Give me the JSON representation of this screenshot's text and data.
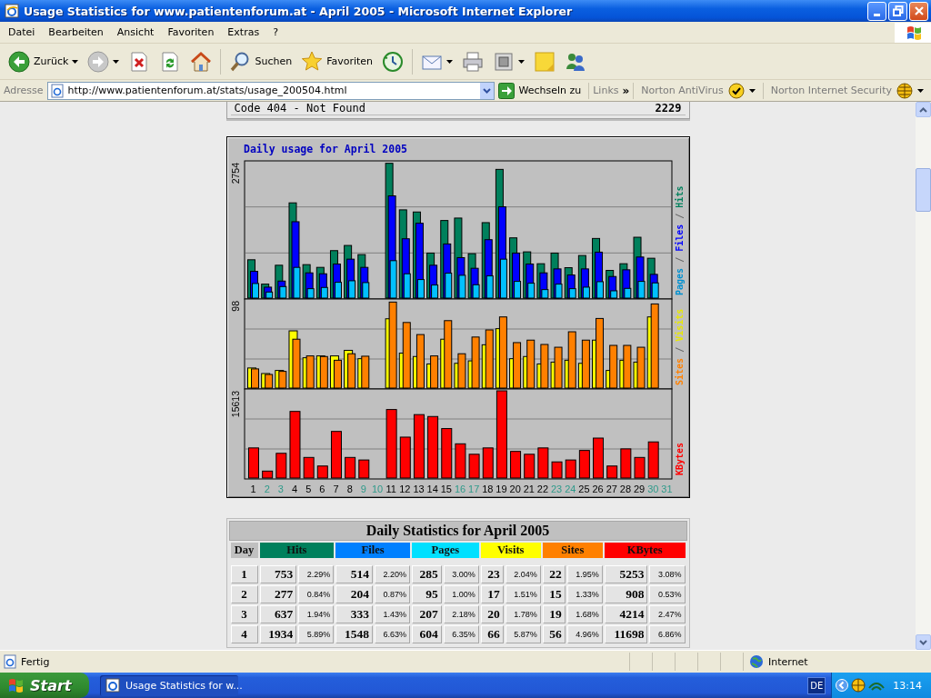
{
  "window": {
    "title": "Usage Statistics for www.patientenforum.at - April 2005 - Microsoft Internet Explorer"
  },
  "menu": [
    "Datei",
    "Bearbeiten",
    "Ansicht",
    "Favoriten",
    "Extras",
    "?"
  ],
  "toolbar": [
    {
      "kind": "back",
      "label": "Zurück"
    },
    {
      "kind": "forward"
    },
    {
      "kind": "stop"
    },
    {
      "kind": "refresh"
    },
    {
      "kind": "home"
    },
    {
      "kind": "search",
      "label": "Suchen"
    },
    {
      "kind": "favorites",
      "label": "Favoriten"
    },
    {
      "kind": "history"
    },
    {
      "kind": "mail"
    },
    {
      "kind": "print"
    },
    {
      "kind": "edit"
    },
    {
      "kind": "note"
    },
    {
      "kind": "messenger"
    }
  ],
  "address_bar": {
    "label": "Adresse",
    "value": "http://www.patientenforum.at/stats/usage_200504.html",
    "go_label": "Wechseln zu"
  },
  "links_bar": {
    "label": "Links",
    "chevron": "»",
    "items": [
      "Norton AntiVirus",
      "Norton Internet Security"
    ]
  },
  "previous_table_row": {
    "label": "Code 404 - Not Found",
    "value": "2229"
  },
  "chart": {
    "title": "Daily usage for April 2005",
    "panels": [
      {
        "max_label": "2754",
        "legend": [
          {
            "text": "Pages",
            "color": "#0090d0"
          },
          {
            "text": " / ",
            "color": "#606060"
          },
          {
            "text": "Files",
            "color": "#0000ff"
          },
          {
            "text": " / ",
            "color": "#606060"
          },
          {
            "text": "Hits",
            "color": "#00805c"
          }
        ]
      },
      {
        "max_label": "98",
        "legend": [
          {
            "text": "Sites",
            "color": "#ff8000"
          },
          {
            "text": " / ",
            "color": "#606060"
          },
          {
            "text": "Visits",
            "color": "#e8e800"
          }
        ]
      },
      {
        "max_label": "15613",
        "legend": [
          {
            "text": "KBytes",
            "color": "#ff0000"
          }
        ]
      }
    ],
    "days": [
      {
        "label": "1",
        "weekend": false
      },
      {
        "label": "2",
        "weekend": true
      },
      {
        "label": "3",
        "weekend": true
      },
      {
        "label": "4",
        "weekend": false
      },
      {
        "label": "5",
        "weekend": false
      },
      {
        "label": "6",
        "weekend": false
      },
      {
        "label": "7",
        "weekend": false
      },
      {
        "label": "8",
        "weekend": false
      },
      {
        "label": "9",
        "weekend": true
      },
      {
        "label": "10",
        "weekend": true
      },
      {
        "label": "11",
        "weekend": false
      },
      {
        "label": "12",
        "weekend": false
      },
      {
        "label": "13",
        "weekend": false
      },
      {
        "label": "14",
        "weekend": false
      },
      {
        "label": "15",
        "weekend": false
      },
      {
        "label": "16",
        "weekend": true
      },
      {
        "label": "17",
        "weekend": true
      },
      {
        "label": "18",
        "weekend": false
      },
      {
        "label": "19",
        "weekend": false
      },
      {
        "label": "20",
        "weekend": false
      },
      {
        "label": "21",
        "weekend": false
      },
      {
        "label": "22",
        "weekend": false
      },
      {
        "label": "23",
        "weekend": true
      },
      {
        "label": "24",
        "weekend": true
      },
      {
        "label": "25",
        "weekend": false
      },
      {
        "label": "26",
        "weekend": false
      },
      {
        "label": "27",
        "weekend": false
      },
      {
        "label": "28",
        "weekend": false
      },
      {
        "label": "29",
        "weekend": false
      },
      {
        "label": "30",
        "weekend": true
      },
      {
        "label": "31",
        "weekend": true
      }
    ]
  },
  "daily_table": {
    "title": "Daily Statistics for April 2005",
    "columns": [
      {
        "label": "Day"
      },
      {
        "label": "Hits",
        "color": "#00805c"
      },
      {
        "label": "Files",
        "color": "#0080ff"
      },
      {
        "label": "Pages",
        "color": "#00e0ff"
      },
      {
        "label": "Visits",
        "color": "#ffff00"
      },
      {
        "label": "Sites",
        "color": "#ff8000"
      },
      {
        "label": "KBytes",
        "color": "#ff0000"
      }
    ],
    "rows": [
      {
        "day": "1",
        "metrics": [
          {
            "count": "753",
            "percent": "2.29%"
          },
          {
            "count": "514",
            "percent": "2.20%"
          },
          {
            "count": "285",
            "percent": "3.00%"
          },
          {
            "count": "23",
            "percent": "2.04%"
          },
          {
            "count": "22",
            "percent": "1.95%"
          },
          {
            "count": "5253",
            "percent": "3.08%"
          }
        ]
      },
      {
        "day": "2",
        "metrics": [
          {
            "count": "277",
            "percent": "0.84%"
          },
          {
            "count": "204",
            "percent": "0.87%"
          },
          {
            "count": "95",
            "percent": "1.00%"
          },
          {
            "count": "17",
            "percent": "1.51%"
          },
          {
            "count": "15",
            "percent": "1.33%"
          },
          {
            "count": "908",
            "percent": "0.53%"
          }
        ]
      },
      {
        "day": "3",
        "metrics": [
          {
            "count": "637",
            "percent": "1.94%"
          },
          {
            "count": "333",
            "percent": "1.43%"
          },
          {
            "count": "207",
            "percent": "2.18%"
          },
          {
            "count": "20",
            "percent": "1.78%"
          },
          {
            "count": "19",
            "percent": "1.68%"
          },
          {
            "count": "4214",
            "percent": "2.47%"
          }
        ]
      },
      {
        "day": "4",
        "metrics": [
          {
            "count": "1934",
            "percent": "5.89%"
          },
          {
            "count": "1548",
            "percent": "6.63%"
          },
          {
            "count": "604",
            "percent": "6.35%"
          },
          {
            "count": "66",
            "percent": "5.87%"
          },
          {
            "count": "56",
            "percent": "4.96%"
          },
          {
            "count": "11698",
            "percent": "6.86%"
          }
        ]
      }
    ]
  },
  "status_bar": {
    "text": "Fertig",
    "zone": "Internet"
  },
  "taskbar": {
    "start": "Start",
    "tasks": [
      "Usage Statistics for w..."
    ],
    "language": "DE",
    "clock": "13:14"
  }
}
